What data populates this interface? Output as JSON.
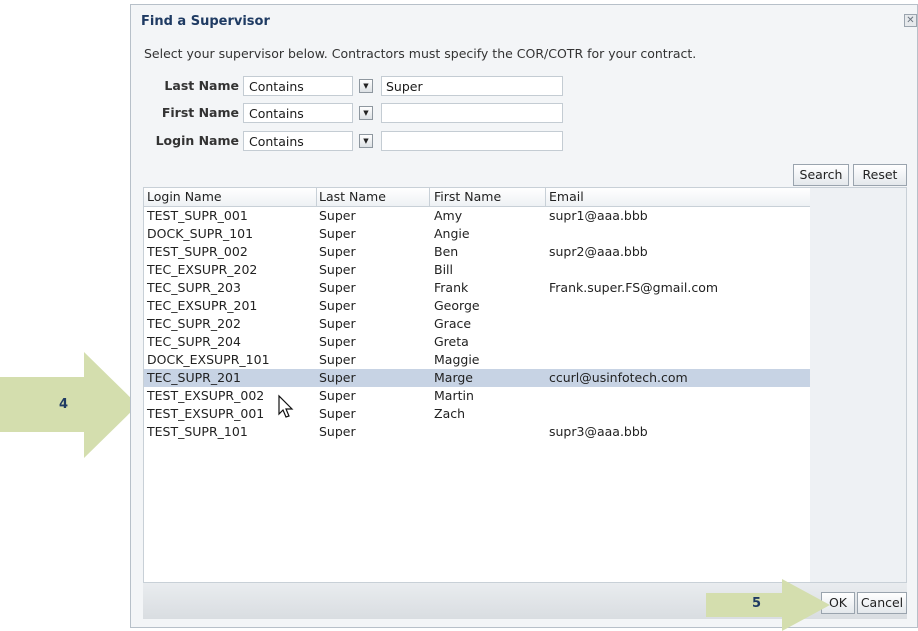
{
  "dialog": {
    "title": "Find a Supervisor",
    "close_glyph": "✕",
    "instructions": "Select your supervisor below. Contractors must specify the COR/COTR for your contract."
  },
  "criteria": [
    {
      "label": "Last Name",
      "operator": "Contains",
      "value": "Super"
    },
    {
      "label": "First Name",
      "operator": "Contains",
      "value": ""
    },
    {
      "label": "Login Name",
      "operator": "Contains",
      "value": ""
    }
  ],
  "buttons": {
    "search": "Search",
    "reset": "Reset",
    "ok": "OK",
    "cancel": "Cancel"
  },
  "table": {
    "columns": [
      "Login Name",
      "Last Name",
      "First Name",
      "Email"
    ],
    "rows": [
      [
        "TEST_SUPR_001",
        "Super",
        "Amy",
        "supr1@aaa.bbb"
      ],
      [
        "DOCK_SUPR_101",
        "Super",
        "Angie",
        ""
      ],
      [
        "TEST_SUPR_002",
        "Super",
        "Ben",
        "supr2@aaa.bbb"
      ],
      [
        "TEC_EXSUPR_202",
        "Super",
        "Bill",
        ""
      ],
      [
        "TEC_SUPR_203",
        "Super",
        "Frank",
        "Frank.super.FS@gmail.com"
      ],
      [
        "TEC_EXSUPR_201",
        "Super",
        "George",
        ""
      ],
      [
        "TEC_SUPR_202",
        "Super",
        "Grace",
        ""
      ],
      [
        "TEC_SUPR_204",
        "Super",
        "Greta",
        ""
      ],
      [
        "DOCK_EXSUPR_101",
        "Super",
        "Maggie",
        ""
      ],
      [
        "TEC_SUPR_201",
        "Super",
        "Marge",
        "ccurl@usinfotech.com"
      ],
      [
        "TEST_EXSUPR_002",
        "Super",
        "Martin",
        ""
      ],
      [
        "TEST_EXSUPR_001",
        "Super",
        "Zach",
        ""
      ],
      [
        "TEST_SUPR_101",
        "Super",
        "",
        "supr3@aaa.bbb"
      ]
    ],
    "selected_row_index": 9
  },
  "callouts": [
    {
      "number": "4",
      "color": "#d4deae"
    },
    {
      "number": "5",
      "color": "#d4deae"
    }
  ],
  "colors": {
    "title": "#1f3b63",
    "selected_row": "#c7d3e4",
    "callout": "#d4deae"
  }
}
